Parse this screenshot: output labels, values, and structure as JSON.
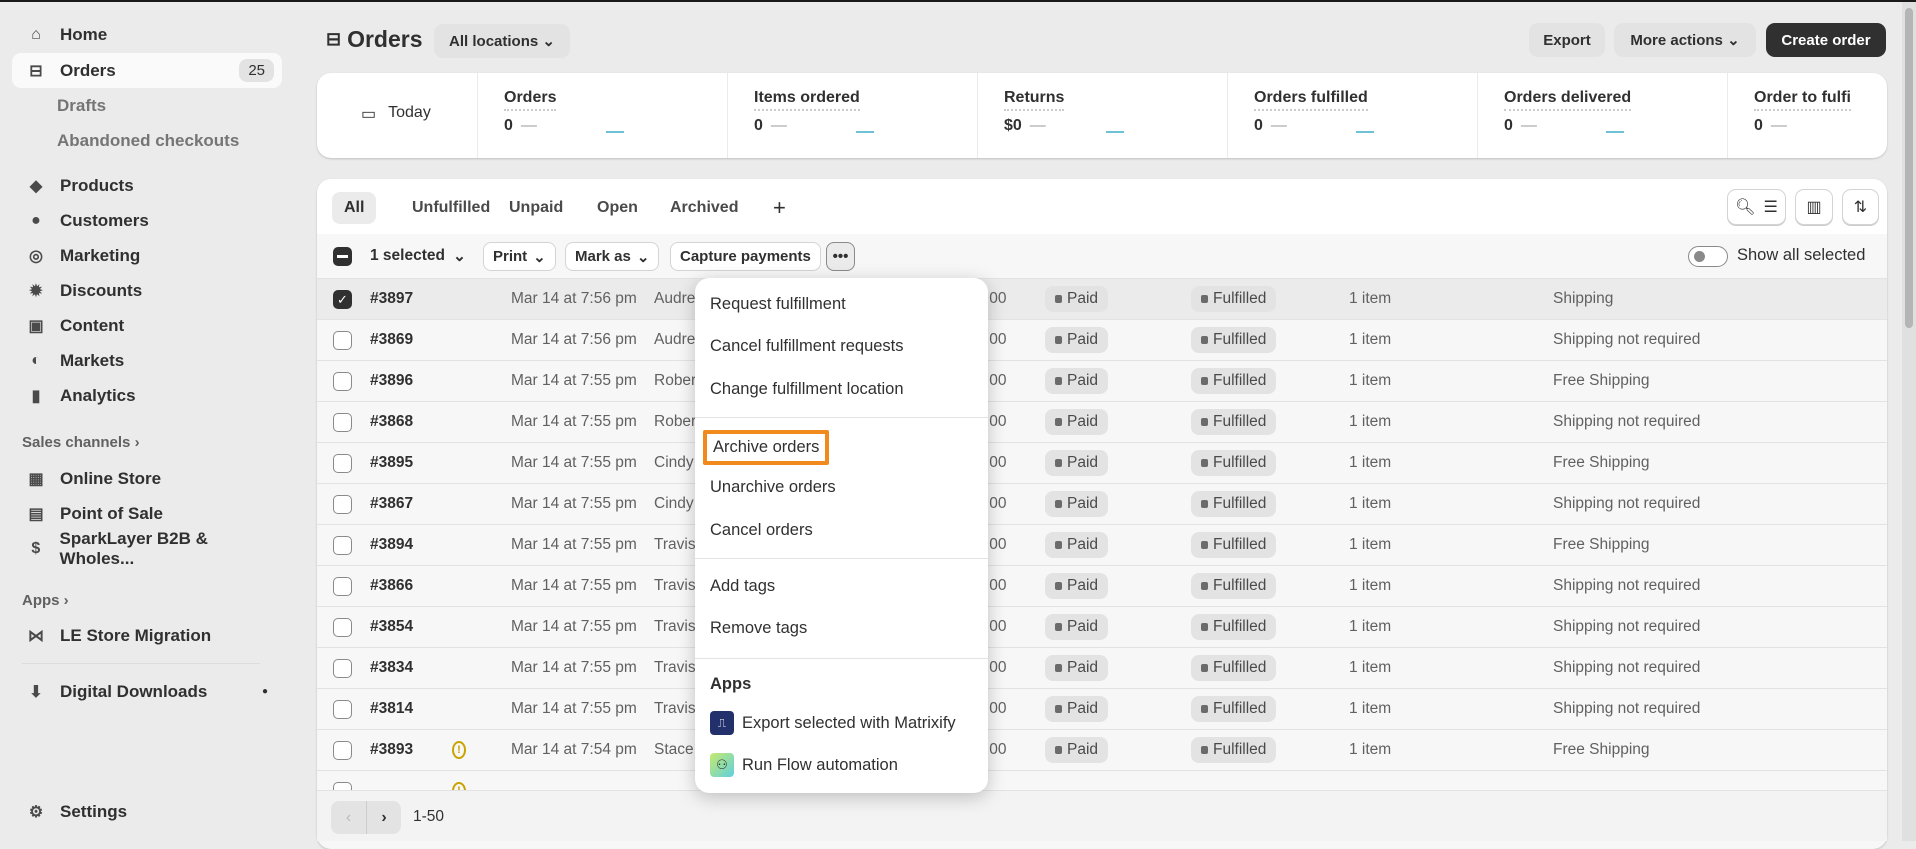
{
  "sidebar": {
    "home": "Home",
    "orders": "Orders",
    "orders_count": "25",
    "drafts": "Drafts",
    "abandoned": "Abandoned checkouts",
    "products": "Products",
    "customers": "Customers",
    "marketing": "Marketing",
    "discounts": "Discounts",
    "content": "Content",
    "markets": "Markets",
    "analytics": "Analytics",
    "sales_channels": "Sales channels",
    "online_store": "Online Store",
    "pos": "Point of Sale",
    "sparklayer": "SparkLayer B2B & Wholes...",
    "apps": "Apps",
    "le_store": "LE Store Migration",
    "digital_downloads": "Digital Downloads",
    "settings": "Settings"
  },
  "header": {
    "title": "Orders",
    "location": "All locations",
    "export": "Export",
    "more_actions": "More actions",
    "create_order": "Create order"
  },
  "stats": {
    "period": "Today",
    "items": [
      {
        "label": "Orders",
        "value": "0"
      },
      {
        "label": "Items ordered",
        "value": "0"
      },
      {
        "label": "Returns",
        "value": "$0"
      },
      {
        "label": "Orders fulfilled",
        "value": "0"
      },
      {
        "label": "Orders delivered",
        "value": "0"
      },
      {
        "label": "Order to fulfi",
        "value": "0"
      }
    ]
  },
  "tabs": [
    "All",
    "Unfulfilled",
    "Unpaid",
    "Open",
    "Archived"
  ],
  "bulk": {
    "selected": "1 selected",
    "print": "Print",
    "mark_as": "Mark as",
    "capture": "Capture payments",
    "show_all": "Show all selected"
  },
  "rows": [
    {
      "id": "#3897",
      "date": "Mar 14 at 7:56 pm",
      "customer": "Audre",
      "total": ".00",
      "payment": "Paid",
      "fulfillment": "Fulfilled",
      "items": "1 item",
      "delivery": "Shipping",
      "checked": true
    },
    {
      "id": "#3869",
      "date": "Mar 14 at 7:56 pm",
      "customer": "Audre",
      "total": ".00",
      "payment": "Paid",
      "fulfillment": "Fulfilled",
      "items": "1 item",
      "delivery": "Shipping not required"
    },
    {
      "id": "#3896",
      "date": "Mar 14 at 7:55 pm",
      "customer": "Rober",
      "total": ".00",
      "payment": "Paid",
      "fulfillment": "Fulfilled",
      "items": "1 item",
      "delivery": "Free Shipping"
    },
    {
      "id": "#3868",
      "date": "Mar 14 at 7:55 pm",
      "customer": "Rober",
      "total": ".00",
      "payment": "Paid",
      "fulfillment": "Fulfilled",
      "items": "1 item",
      "delivery": "Shipping not required"
    },
    {
      "id": "#3895",
      "date": "Mar 14 at 7:55 pm",
      "customer": "Cindy",
      "total": ".00",
      "payment": "Paid",
      "fulfillment": "Fulfilled",
      "items": "1 item",
      "delivery": "Free Shipping"
    },
    {
      "id": "#3867",
      "date": "Mar 14 at 7:55 pm",
      "customer": "Cindy",
      "total": ".00",
      "payment": "Paid",
      "fulfillment": "Fulfilled",
      "items": "1 item",
      "delivery": "Shipping not required"
    },
    {
      "id": "#3894",
      "date": "Mar 14 at 7:55 pm",
      "customer": "Travis",
      "total": ".00",
      "payment": "Paid",
      "fulfillment": "Fulfilled",
      "items": "1 item",
      "delivery": "Free Shipping"
    },
    {
      "id": "#3866",
      "date": "Mar 14 at 7:55 pm",
      "customer": "Travis",
      "total": ".00",
      "payment": "Paid",
      "fulfillment": "Fulfilled",
      "items": "1 item",
      "delivery": "Shipping not required"
    },
    {
      "id": "#3854",
      "date": "Mar 14 at 7:55 pm",
      "customer": "Travis",
      "total": ".00",
      "payment": "Paid",
      "fulfillment": "Fulfilled",
      "items": "1 item",
      "delivery": "Shipping not required"
    },
    {
      "id": "#3834",
      "date": "Mar 14 at 7:55 pm",
      "customer": "Travis",
      "total": ".00",
      "payment": "Paid",
      "fulfillment": "Fulfilled",
      "items": "1 item",
      "delivery": "Shipping not required"
    },
    {
      "id": "#3814",
      "date": "Mar 14 at 7:55 pm",
      "customer": "Travis",
      "total": ".00",
      "payment": "Paid",
      "fulfillment": "Fulfilled",
      "items": "1 item",
      "delivery": "Shipping not required"
    },
    {
      "id": "#3893",
      "date": "Mar 14 at 7:54 pm",
      "customer": "Stace",
      "total": ".00",
      "payment": "Paid",
      "fulfillment": "Fulfilled",
      "items": "1 item",
      "delivery": "Free Shipping",
      "warning": true
    }
  ],
  "menu": {
    "items": [
      "Request fulfillment",
      "Cancel fulfillment requests",
      "Change fulfillment location",
      "Archive orders",
      "Unarchive orders",
      "Cancel orders",
      "Add tags",
      "Remove tags"
    ],
    "apps_heading": "Apps",
    "apps": [
      "Export selected with Matrixify",
      "Run Flow automation"
    ],
    "highlight_color": "#f08a1c"
  },
  "pagination": {
    "range": "1-50"
  }
}
